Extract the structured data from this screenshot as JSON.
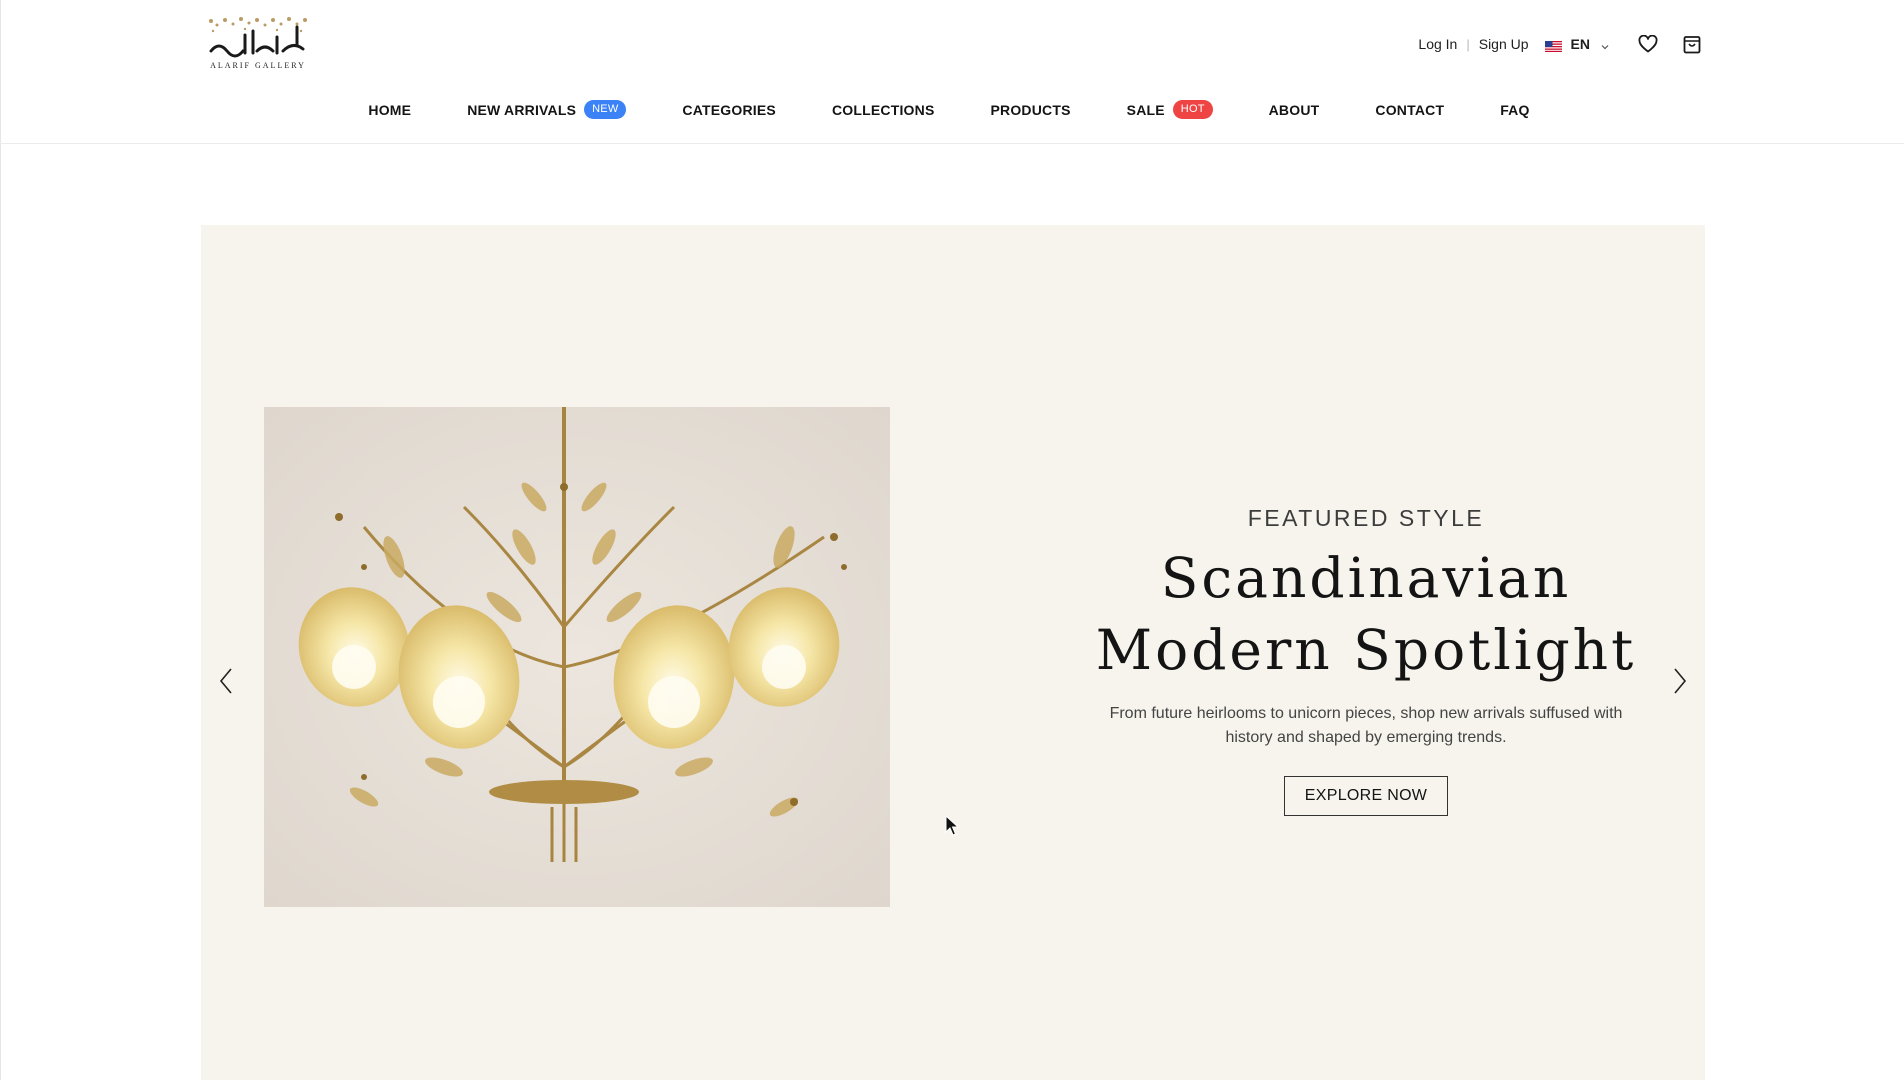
{
  "brand": {
    "logo_text": "العريف",
    "logo_caption": "ALARIF GALLERY"
  },
  "header": {
    "login_label": "Log In",
    "separator": "|",
    "signup_label": "Sign Up",
    "language": {
      "code": "EN",
      "flag_icon": "us-flag-icon"
    },
    "wishlist_icon": "heart-icon",
    "cart_icon": "shopping-bag-icon"
  },
  "nav": {
    "items": [
      {
        "label": "HOME"
      },
      {
        "label": "NEW ARRIVALS",
        "badge": "NEW"
      },
      {
        "label": "CATEGORIES"
      },
      {
        "label": "COLLECTIONS"
      },
      {
        "label": "PRODUCTS"
      },
      {
        "label": "SALE",
        "badge": "HOT"
      },
      {
        "label": "ABOUT"
      },
      {
        "label": "CONTACT"
      },
      {
        "label": "FAQ"
      }
    ]
  },
  "hero": {
    "eyebrow": "FEATURED STYLE",
    "title_line1": "Scandinavian",
    "title_line2": "Modern Spotlight",
    "description": "From future heirlooms to unicorn pieces, shop new arrivals suffused with history and shaped by emerging trends.",
    "cta_label": "EXPLORE NOW",
    "prev_icon": "chevron-left-icon",
    "next_icon": "chevron-right-icon"
  },
  "colors": {
    "hero_background": "#f6f4ec",
    "badge_new": "#3b82f6",
    "badge_hot": "#ef4444",
    "image_background": "#e4ddd5"
  }
}
